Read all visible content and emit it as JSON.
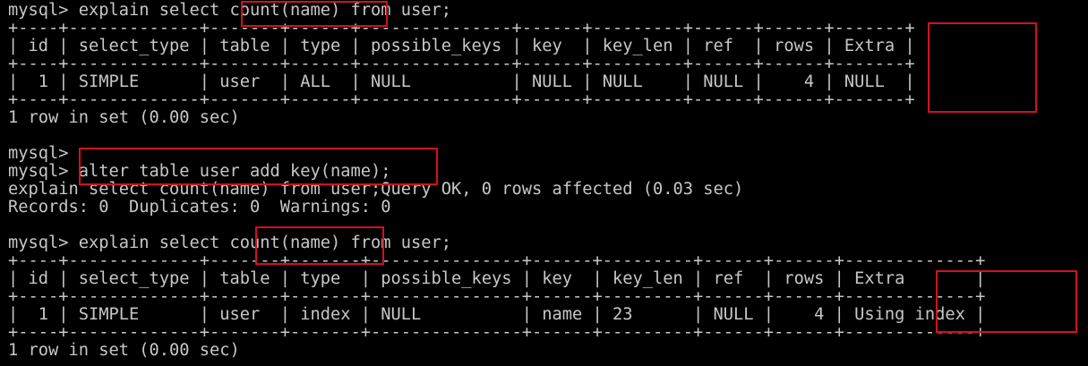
{
  "terminal": {
    "lines": [
      "mysql> explain select count(name) from user;",
      "+----+-------------+-------+------+---------------+------+---------+------+------+-------+",
      "| id | select_type | table | type | possible_keys | key  | key_len | ref  | rows | Extra |",
      "+----+-------------+-------+------+---------------+------+---------+------+------+-------+",
      "|  1 | SIMPLE      | user  | ALL  | NULL          | NULL | NULL    | NULL |    4 | NULL  |",
      "+----+-------------+-------+------+---------------+------+---------+------+------+-------+",
      "1 row in set (0.00 sec)",
      "",
      "mysql>",
      "mysql> alter table user add key(name);",
      "explain select count(name) from user;Query OK, 0 rows affected (0.03 sec)",
      "Records: 0  Duplicates: 0  Warnings: 0",
      "",
      "mysql> explain select count(name) from user;",
      "+----+-------------+-------+-------+---------------+------+---------+------+------+-------------+",
      "| id | select_type | table | type  | possible_keys | key  | key_len | ref  | rows | Extra       |",
      "+----+-------------+-------+-------+---------------+------+---------+------+------+-------------+",
      "|  1 | SIMPLE      | user  | index | NULL          | name | 23      | NULL |    4 | Using index |",
      "+----+-------------+-------+-------+---------------+------+---------+------+------+-------------+",
      "1 row in set (0.00 sec)"
    ]
  },
  "colors": {
    "background": "#000000",
    "text": "#c7c7c7",
    "highlight_border": "#d0121d"
  }
}
